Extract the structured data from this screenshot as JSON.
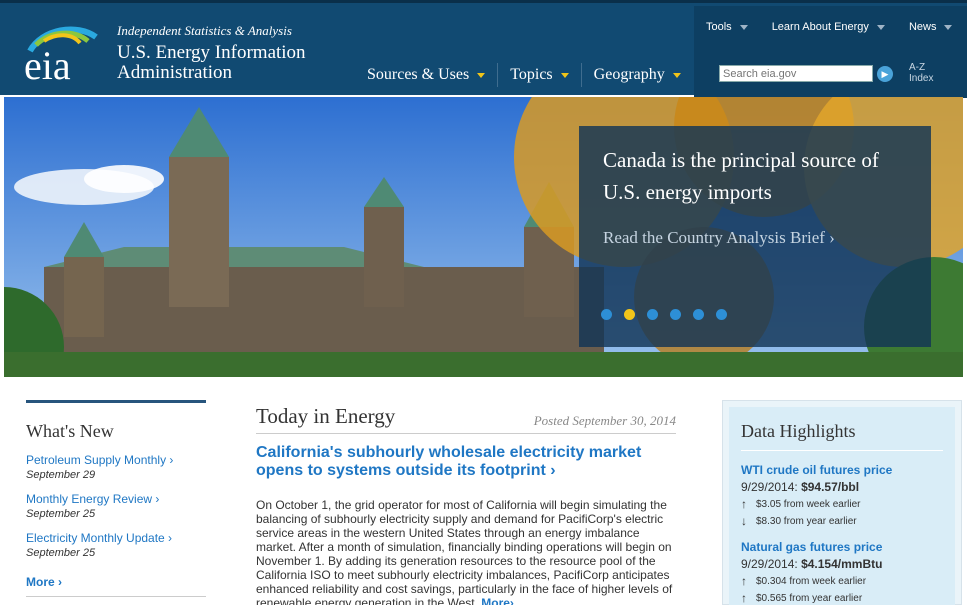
{
  "header": {
    "tagline": "Independent Statistics & Analysis",
    "name_line1": "U.S. Energy Information",
    "name_line2": "Administration",
    "logo_text": "eia",
    "nav": [
      {
        "label": "Sources & Uses"
      },
      {
        "label": "Topics"
      },
      {
        "label": "Geography"
      }
    ],
    "util_nav": [
      {
        "label": "Tools"
      },
      {
        "label": "Learn About Energy"
      },
      {
        "label": "News"
      }
    ],
    "search": {
      "placeholder": "Search eia.gov"
    },
    "az_index": {
      "line1": "A-Z",
      "line2": "Index"
    }
  },
  "hero": {
    "title": "Canada is the principal source of U.S. energy imports",
    "link": "Read the Country Analysis Brief ›",
    "slide_count": 6,
    "active_slide": 2
  },
  "whats_new": {
    "title": "What's New",
    "items": [
      {
        "label": "Petroleum Supply Monthly  ›",
        "date": "September 29"
      },
      {
        "label": "Monthly Energy Review ›",
        "date": "September 25"
      },
      {
        "label": "Electricity Monthly Update ›",
        "date": "September 25"
      }
    ],
    "more": "More ›"
  },
  "today_in_energy": {
    "title": "Today in Energy",
    "posted": "Posted September 30, 2014",
    "headline": "California's subhourly wholesale electricity market opens to systems outside its footprint ›",
    "body": "On October 1, the grid operator for most of California will begin simulating the balancing of subhourly electricity supply and demand for PacifiCorp's electric service areas in the western United States through an energy imbalance market. After a month of simulation, financially binding operations will begin on November 1. By adding its generation resources to the resource pool of the California ISO to meet subhourly electricity imbalances, PacifiCorp anticipates enhanced reliability and cost savings, particularly in the face of higher levels of renewable energy generation in the West.",
    "more": "More›"
  },
  "data_highlights": {
    "title": "Data Highlights",
    "items": [
      {
        "label": "WTI crude oil futures price",
        "date": "9/29/2014:",
        "value": "$94.57/bbl",
        "week": "$3.05 from week earlier",
        "week_dir": "up",
        "year": "$8.30 from year earlier",
        "year_dir": "down"
      },
      {
        "label": "Natural gas futures price",
        "date": "9/29/2014:",
        "value": "$4.154/mmBtu",
        "week": "$0.304 from week earlier",
        "week_dir": "up",
        "year": "$0.565 from year earlier",
        "year_dir": "up"
      }
    ]
  },
  "colors": {
    "header_bg": "#114a72",
    "link_blue": "#1f77c4",
    "accent_yellow": "#f2c51a",
    "dot_blue": "#2d8fd6"
  }
}
